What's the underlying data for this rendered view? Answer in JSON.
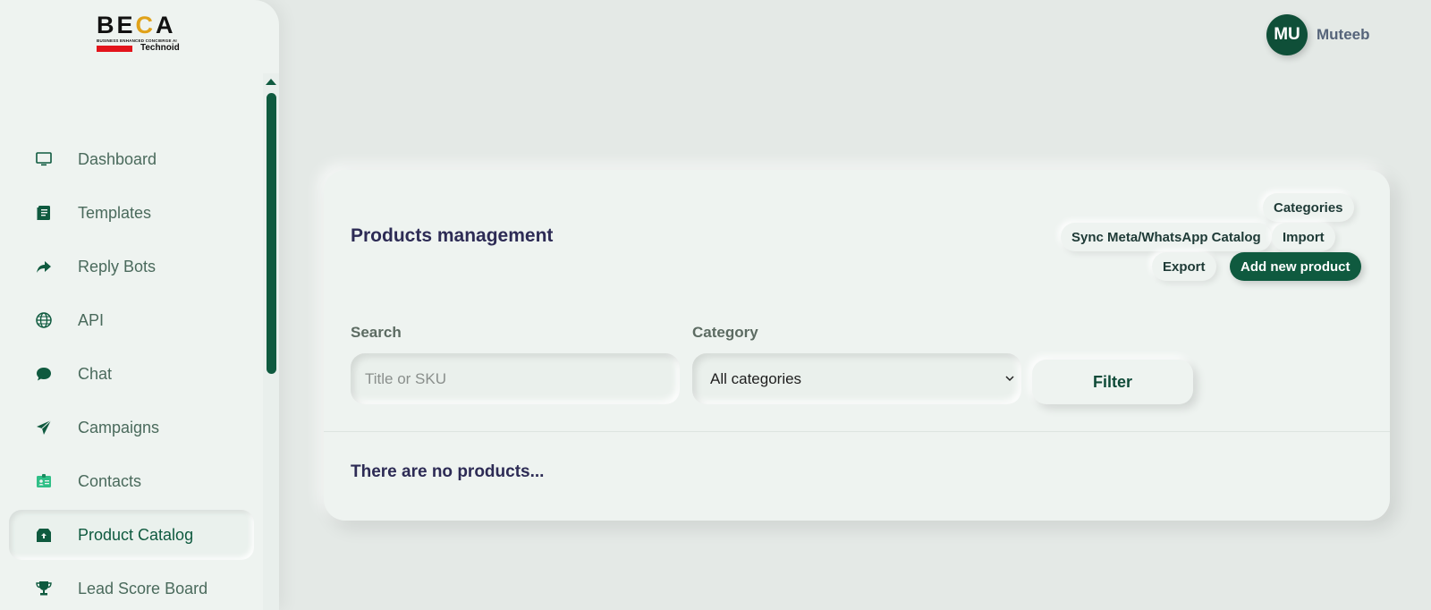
{
  "brand": {
    "name_prefix": "BE",
    "name_c": "C",
    "name_suffix": "A",
    "tagline": "BUSINESS ENHANCED CONCIERGE AI",
    "sub": "Technoid"
  },
  "sidebar": {
    "items": [
      {
        "label": "Dashboard",
        "icon": "monitor-icon"
      },
      {
        "label": "Templates",
        "icon": "document-icon"
      },
      {
        "label": "Reply Bots",
        "icon": "share-arrow-icon"
      },
      {
        "label": "API",
        "icon": "globe-icon"
      },
      {
        "label": "Chat",
        "icon": "chat-bubble-icon"
      },
      {
        "label": "Campaigns",
        "icon": "paper-plane-icon"
      },
      {
        "label": "Contacts",
        "icon": "contact-card-icon"
      },
      {
        "label": "Product Catalog",
        "icon": "box-icon",
        "active": true
      },
      {
        "label": "Lead Score Board",
        "icon": "trophy-icon"
      }
    ]
  },
  "user": {
    "initials": "MU",
    "name": "Muteeb"
  },
  "products": {
    "title": "Products management",
    "actions": {
      "categories": "Categories",
      "sync": "Sync Meta/WhatsApp Catalog",
      "import": "Import",
      "export": "Export",
      "add": "Add new product"
    },
    "search_label": "Search",
    "search_placeholder": "Title or SKU",
    "search_value": "",
    "category_label": "Category",
    "category_selected": "All categories",
    "filter_label": "Filter",
    "empty_message": "There are no products..."
  },
  "colors": {
    "brand_green": "#0f5a3f",
    "title_navy": "#2d2b55",
    "background": "#e4e9e6"
  }
}
